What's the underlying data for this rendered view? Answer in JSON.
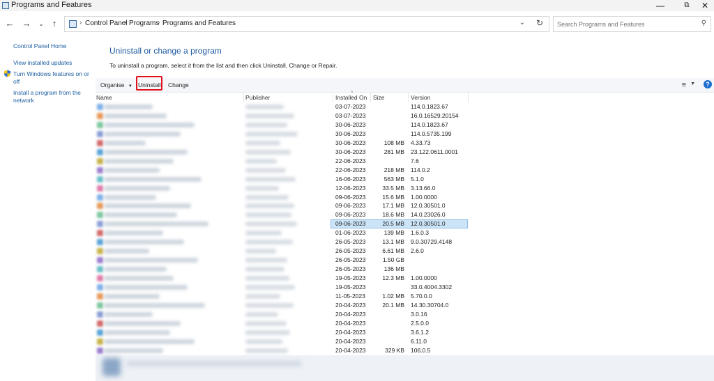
{
  "window": {
    "title": "Programs and Features"
  },
  "address": {
    "crumbs": [
      "Control Panel",
      "Programs",
      "Programs and Features"
    ]
  },
  "search": {
    "placeholder": "Search Programs and Features"
  },
  "sidebar": {
    "home": "Control Panel Home",
    "updates": "View installed updates",
    "features_line1": "Turn Windows features on or",
    "features_line2": "off",
    "install_line1": "Install a program from the",
    "install_line2": "network"
  },
  "main": {
    "title": "Uninstall or change a program",
    "description": "To uninstall a program, select it from the list and then click Uninstall, Change or Repair."
  },
  "toolbar": {
    "organise": "Organise",
    "uninstall": "Uninstall",
    "change": "Change"
  },
  "columns": {
    "name": "Name",
    "publisher": "Publisher",
    "installed_on": "Installed On",
    "size": "Size",
    "version": "Version"
  },
  "selected_row_index": 13,
  "rows": [
    {
      "installed": "03-07-2023",
      "size": "",
      "version": "114.0.1823.67"
    },
    {
      "installed": "03-07-2023",
      "size": "",
      "version": "16.0.16529.20154"
    },
    {
      "installed": "30-06-2023",
      "size": "",
      "version": "114.0.1823.67"
    },
    {
      "installed": "30-06-2023",
      "size": "",
      "version": "114.0.5735.199"
    },
    {
      "installed": "30-06-2023",
      "size": "108 MB",
      "version": "4.33.73"
    },
    {
      "installed": "30-06-2023",
      "size": "281 MB",
      "version": "23.122.0611.0001"
    },
    {
      "installed": "22-06-2023",
      "size": "",
      "version": "7.6"
    },
    {
      "installed": "22-06-2023",
      "size": "218 MB",
      "version": "114.0.2"
    },
    {
      "installed": "16-06-2023",
      "size": "563 MB",
      "version": "5.1.0"
    },
    {
      "installed": "12-06-2023",
      "size": "33.5 MB",
      "version": "3.13.66.0"
    },
    {
      "installed": "09-06-2023",
      "size": "15.6 MB",
      "version": "1.00.0000"
    },
    {
      "installed": "09-06-2023",
      "size": "17.1 MB",
      "version": "12.0.30501.0"
    },
    {
      "installed": "09-06-2023",
      "size": "18.6 MB",
      "version": "14.0.23026.0"
    },
    {
      "installed": "09-06-2023",
      "size": "20.5 MB",
      "version": "12.0.30501.0"
    },
    {
      "installed": "01-06-2023",
      "size": "139 MB",
      "version": "1.6.0.3"
    },
    {
      "installed": "26-05-2023",
      "size": "13.1 MB",
      "version": "9.0.30729.4148"
    },
    {
      "installed": "26-05-2023",
      "size": "6.61 MB",
      "version": "2.6.0"
    },
    {
      "installed": "26-05-2023",
      "size": "1.50 GB",
      "version": ""
    },
    {
      "installed": "26-05-2023",
      "size": "136 MB",
      "version": ""
    },
    {
      "installed": "19-05-2023",
      "size": "12.3 MB",
      "version": "1.00.0000"
    },
    {
      "installed": "19-05-2023",
      "size": "",
      "version": "33.0.4004.3302"
    },
    {
      "installed": "11-05-2023",
      "size": "1.02 MB",
      "version": "5.70.0.0"
    },
    {
      "installed": "20-04-2023",
      "size": "20.1 MB",
      "version": "14.30.30704.0"
    },
    {
      "installed": "20-04-2023",
      "size": "",
      "version": "3.0.16"
    },
    {
      "installed": "20-04-2023",
      "size": "",
      "version": "2.5.0.0"
    },
    {
      "installed": "20-04-2023",
      "size": "",
      "version": "3.6.1.2"
    },
    {
      "installed": "20-04-2023",
      "size": "",
      "version": "6.11.0"
    },
    {
      "installed": "20-04-2023",
      "size": "329 KB",
      "version": "106.0.5"
    }
  ],
  "colors": {
    "accent": "#1e5aa0",
    "selection": "#cce4f7",
    "highlight_box": "#e0111b",
    "link": "#1d5fa3"
  },
  "icons": {
    "back": "back-arrow-icon",
    "forward": "forward-arrow-icon",
    "recent": "chevron-down-icon",
    "up": "up-arrow-icon",
    "refresh": "refresh-icon",
    "search": "search-icon",
    "help": "help-icon",
    "view": "view-options-icon",
    "shield": "shield-icon"
  }
}
